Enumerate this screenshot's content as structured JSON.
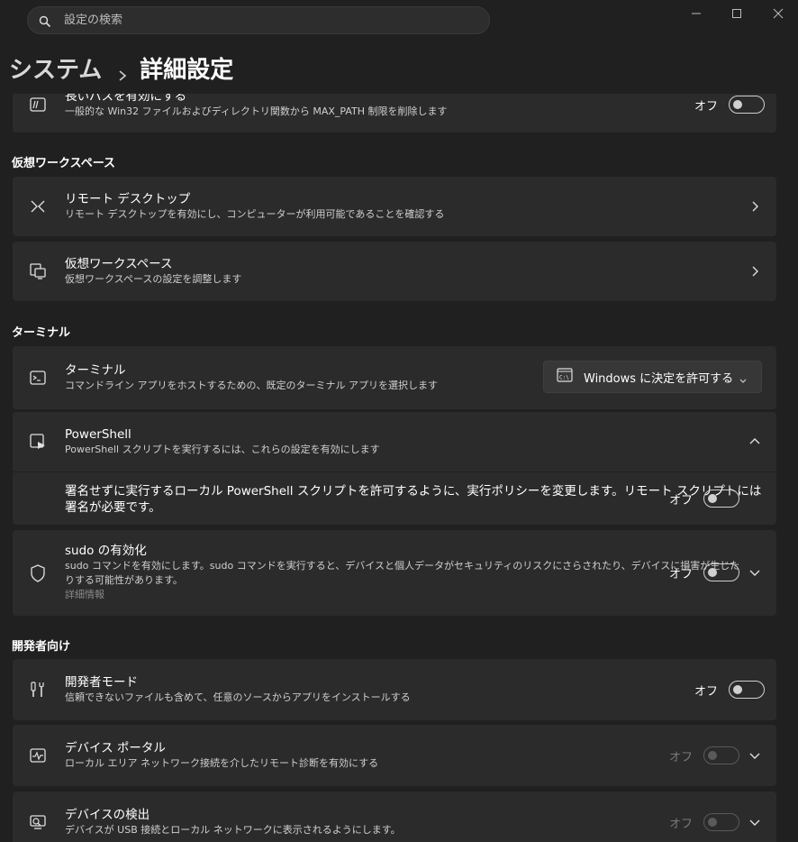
{
  "search": {
    "placeholder": "設定の検索"
  },
  "breadcrumb": {
    "parent": "システム",
    "current": "詳細設定"
  },
  "toggle_off": "オフ",
  "long_path": {
    "title": "長いパスを有効にする",
    "description": "一般的な Win32 ファイルおよびディレクトリ関数から MAX_PATH 制限を削除します"
  },
  "sections": {
    "virtual_workspace": "仮想ワークスペース",
    "terminal": "ターミナル",
    "developer": "開発者向け"
  },
  "remote_desktop": {
    "title": "リモート デスクトップ",
    "description": "リモート デスクトップを有効にし、コンピューターが利用可能であることを確認する"
  },
  "virtual_ws": {
    "title": "仮想ワークスペース",
    "description": "仮想ワークスペースの設定を調整します"
  },
  "terminal": {
    "title": "ターミナル",
    "description": "コマンドライン アプリをホストするための、既定のターミナル アプリを選択します",
    "dropdown_value": "Windows に決定を許可する"
  },
  "powershell": {
    "title": "PowerShell",
    "description": "PowerShell スクリプトを実行するには、これらの設定を有効にします",
    "policy_line1": "署名せずに実行するローカル PowerShell スクリプトを許可するように、実行ポリシーを変更します。リモート スクリプトには",
    "policy_line2": "署名が必要です。"
  },
  "sudo": {
    "title": "sudo の有効化",
    "description_line1": "sudo コマンドを有効にします。sudo コマンドを実行すると、デバイスと個人データがセキュリティのリスクにさらされたり、デバイスに損害が生じた",
    "description_line2": "りする可能性があります。",
    "link": "詳細情報"
  },
  "developer_mode": {
    "title": "開発者モード",
    "description": "信頼できないファイルも含めて、任意のソースからアプリをインストールする"
  },
  "device_portal": {
    "title": "デバイス ポータル",
    "description": "ローカル エリア ネットワーク接続を介したリモート診断を有効にする"
  },
  "device_discovery": {
    "title": "デバイスの検出",
    "description": "デバイスが USB 接続とローカル ネットワークに表示されるようにします。"
  }
}
